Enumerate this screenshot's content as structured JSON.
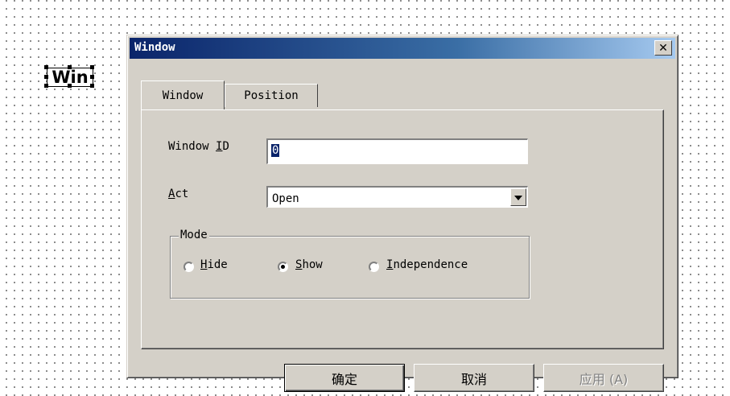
{
  "canvas_widget": {
    "label": "Win"
  },
  "dialog": {
    "title": "Window",
    "close_label": "✕",
    "tabs": [
      {
        "label": "Window",
        "active": true
      },
      {
        "label": "Position",
        "active": false
      }
    ],
    "fields": {
      "window_id": {
        "label_pre": "Window ",
        "label_hotkey": "I",
        "label_post": "D",
        "value": "0"
      },
      "act": {
        "label_hotkey": "A",
        "label_post": "ct",
        "value": "Open"
      }
    },
    "mode_group": {
      "title": "Mode",
      "options": [
        {
          "hotkey": "H",
          "rest": "ide",
          "selected": false
        },
        {
          "hotkey": "S",
          "rest": "how",
          "selected": true
        },
        {
          "hotkey": "I",
          "rest": "ndependence",
          "selected": false
        }
      ]
    },
    "buttons": {
      "ok": "确定",
      "cancel": "取消",
      "apply": "应用 (A)"
    }
  },
  "colors": {
    "title_start": "#0a246a",
    "title_end": "#a6caf0",
    "face": "#d4d0c8",
    "selection": "#0a246a"
  }
}
